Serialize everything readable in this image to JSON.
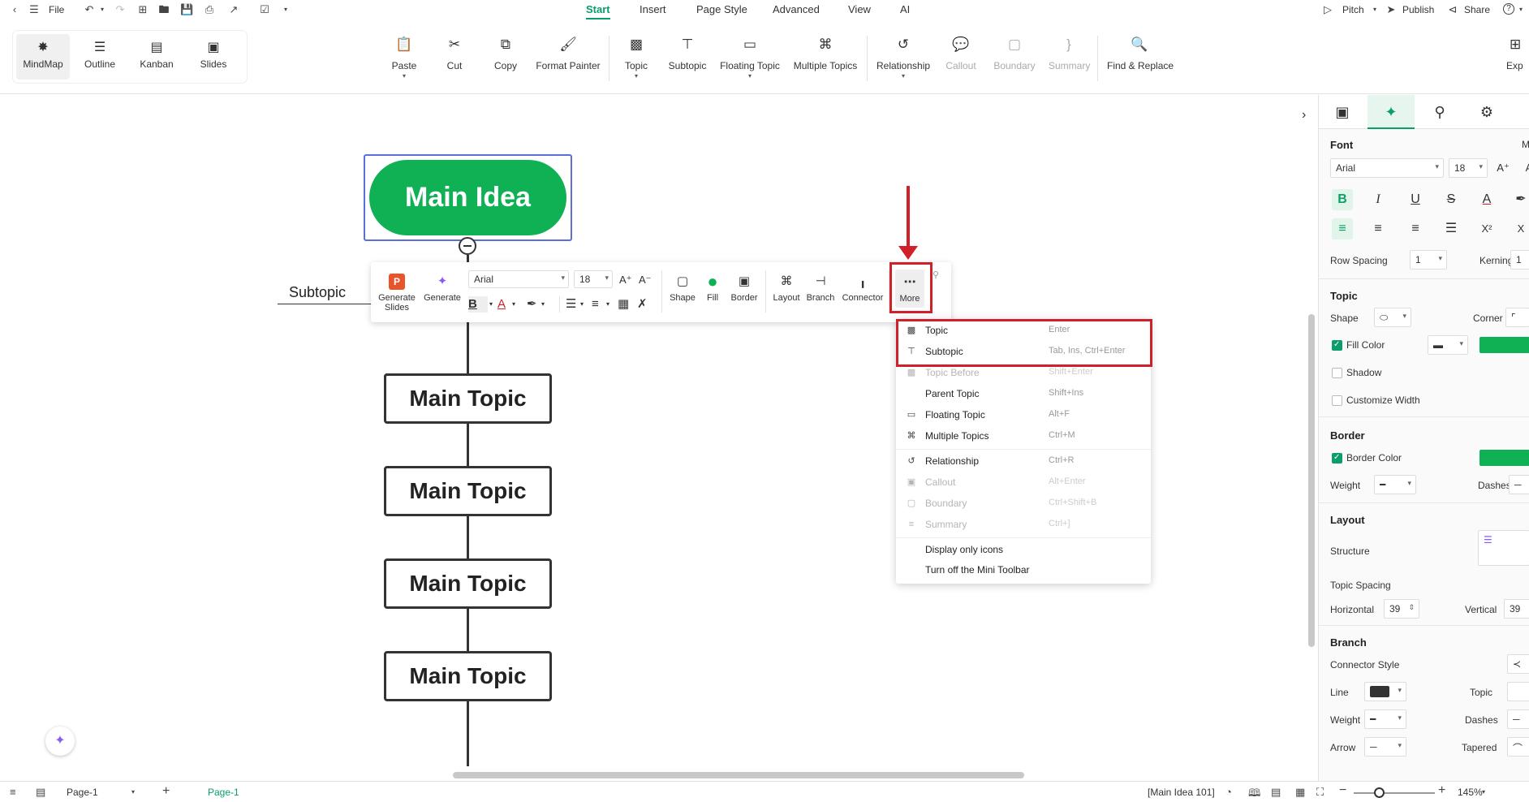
{
  "menubar": {
    "file": "File",
    "tabs": [
      "Start",
      "Insert",
      "Page Style",
      "Advanced",
      "View",
      "AI"
    ],
    "pitch": "Pitch",
    "publish": "Publish",
    "share": "Share",
    "help": "?"
  },
  "views": [
    "MindMap",
    "Outline",
    "Kanban",
    "Slides"
  ],
  "ribbon": {
    "paste": "Paste",
    "cut": "Cut",
    "copy": "Copy",
    "format_painter": "Format Painter",
    "topic": "Topic",
    "subtopic": "Subtopic",
    "floating_topic": "Floating Topic",
    "multiple_topics": "Multiple Topics",
    "relationship": "Relationship",
    "callout": "Callout",
    "boundary": "Boundary",
    "summary": "Summary",
    "find_replace": "Find & Replace",
    "export": "Exp"
  },
  "canvas": {
    "main_idea": "Main Idea",
    "subtopic": "Subtopic",
    "topics": [
      "Main Topic",
      "Main Topic",
      "Main Topic",
      "Main Topic"
    ],
    "accent": "#10b155"
  },
  "mini_toolbar": {
    "generate_slides": [
      "Generate",
      "Slides"
    ],
    "generate": "Generate",
    "font": "Arial",
    "size": "18",
    "shape": "Shape",
    "fill": "Fill",
    "border": "Border",
    "layout": "Layout",
    "branch": "Branch",
    "connector": "Connector",
    "more": "More"
  },
  "context_menu": [
    {
      "label": "Topic",
      "shortcut": "Enter",
      "disabled": false
    },
    {
      "label": "Subtopic",
      "shortcut": "Tab, Ins, Ctrl+Enter",
      "disabled": false
    },
    {
      "label": "Topic Before",
      "shortcut": "Shift+Enter",
      "disabled": true
    },
    {
      "label": "Parent Topic",
      "shortcut": "Shift+Ins",
      "disabled": false
    },
    {
      "label": "Floating Topic",
      "shortcut": "Alt+F",
      "disabled": false
    },
    {
      "label": "Multiple Topics",
      "shortcut": "Ctrl+M",
      "disabled": false
    },
    {
      "label": "Relationship",
      "shortcut": "Ctrl+R",
      "disabled": false
    },
    {
      "label": "Callout",
      "shortcut": "Alt+Enter",
      "disabled": true
    },
    {
      "label": "Boundary",
      "shortcut": "Ctrl+Shift+B",
      "disabled": true
    },
    {
      "label": "Summary",
      "shortcut": "Ctrl+]",
      "disabled": true
    },
    {
      "label": "Display only icons",
      "shortcut": "",
      "disabled": false
    },
    {
      "label": "Turn off the Mini Toolbar",
      "shortcut": "",
      "disabled": false
    }
  ],
  "right_panel": {
    "font_heading": "Font",
    "font_name": "Arial",
    "font_size": "18",
    "row_spacing_label": "Row Spacing",
    "row_spacing": "1",
    "kerning_label": "Kerning",
    "kerning": "1",
    "topic_heading": "Topic",
    "shape_label": "Shape",
    "corner_label": "Corner",
    "fill_color_label": "Fill Color",
    "shadow_label": "Shadow",
    "customize_width_label": "Customize Width",
    "border_heading": "Border",
    "border_color_label": "Border Color",
    "weight_label": "Weight",
    "dashes_label": "Dashes",
    "layout_heading": "Layout",
    "structure_label": "Structure",
    "topic_spacing_label": "Topic Spacing",
    "horizontal_label": "Horizontal",
    "horizontal": "39",
    "vertical_label": "Vertical",
    "vertical": "39",
    "branch_heading": "Branch",
    "connector_style_label": "Connector Style",
    "line_label": "Line",
    "topic_label": "Topic",
    "branch_weight_label": "Weight",
    "branch_dashes_label": "Dashes",
    "arrow_label": "Arrow",
    "tapered_label": "Tapered",
    "m_cut": "M"
  },
  "statusbar": {
    "page_select": "Page-1",
    "page_tab": "Page-1",
    "selection": "[Main Idea 101]",
    "zoom": "145%"
  }
}
